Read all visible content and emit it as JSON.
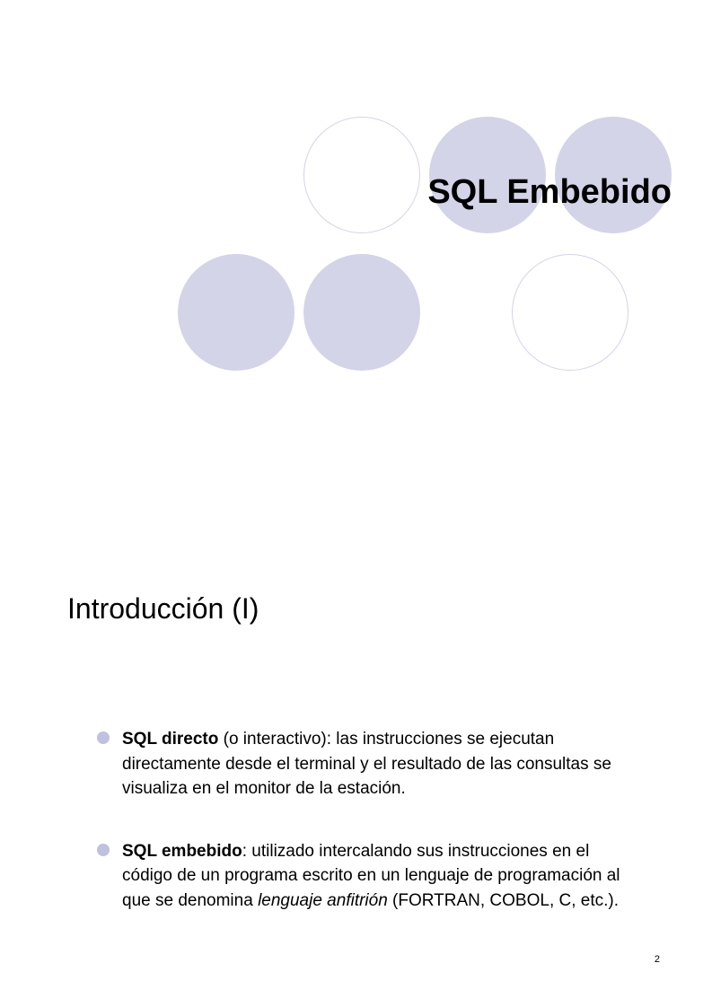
{
  "title": "SQL Embebido",
  "section_title": "Introducción (I)",
  "bullets": [
    {
      "bold_lead": "SQL directo",
      "rest_before_italic": " (o interactivo): las instrucciones se ejecutan directamente desde el terminal y el resultado de las consultas se visualiza en el monitor de la estación.",
      "italic": "",
      "rest_after_italic": ""
    },
    {
      "bold_lead": "SQL embebido",
      "rest_before_italic": ": utilizado intercalando sus instrucciones en el código de un programa escrito en un lenguaje de programación al que se denomina ",
      "italic": "lenguaje anfitrión",
      "rest_after_italic": " (FORTRAN, COBOL, C, etc.)."
    }
  ],
  "page_number": "2"
}
